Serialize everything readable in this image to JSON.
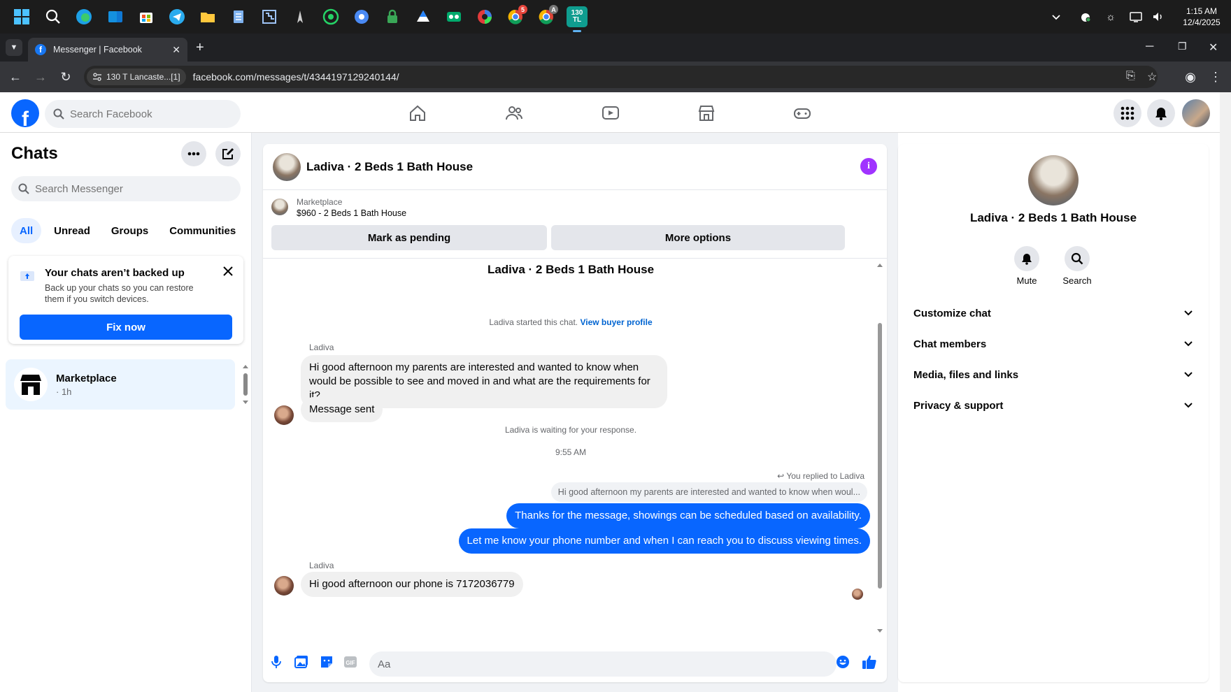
{
  "taskbar": {
    "icons": [
      "windows-start",
      "search",
      "edge",
      "outlook",
      "store",
      "telegram",
      "file-explorer",
      "notepad",
      "snipping",
      "game",
      "whatsapp",
      "chrome-blue",
      "lock-app",
      "drive",
      "tripadvisor",
      "colors",
      "chrome",
      "chrome-profile",
      "trello"
    ],
    "chrome_badge": "5",
    "profile_badge": "A",
    "active_app_label": "130\nTL",
    "time": "1:15 AM",
    "date": "12/4/2025"
  },
  "browser": {
    "tab_title": "Messenger | Facebook",
    "site_chip": "130 T Lancaste...[1]",
    "url": "facebook.com/messages/t/4344197129240144/"
  },
  "fb": {
    "search_placeholder": "Search Facebook"
  },
  "chats": {
    "title": "Chats",
    "search_placeholder": "Search Messenger",
    "filters": [
      "All",
      "Unread",
      "Groups",
      "Communities"
    ],
    "backup_title": "Your chats aren’t backed up",
    "backup_body": "Back up your chats so you can restore them if you switch devices.",
    "fix_now": "Fix now",
    "item_name": "Marketplace",
    "item_time": "· 1h"
  },
  "conversation": {
    "title": "Ladiva · 2 Beds 1 Bath House",
    "marketplace_label": "Marketplace",
    "listing": "$960 - 2 Beds 1 Bath House",
    "mark_pending": "Mark as pending",
    "more_options": "More options",
    "started_text": "Ladiva started this chat.",
    "view_buyer_profile": "View buyer profile",
    "sender": "Ladiva",
    "msg1": "Hi good afternoon my parents are interested and wanted to know when would be possible to see and moved in and what are the requirements for it?",
    "msg2": "Message sent",
    "waiting": "Ladiva is waiting for your response.",
    "timestamp": "9:55 AM",
    "replied": "You replied to Ladiva",
    "quoted": "Hi good afternoon my parents are interested and wanted to know when woul...",
    "out1": "Thanks for the message, showings can be scheduled based on availability.",
    "out2": "Let me know your phone number and when I can reach you to discuss viewing times.",
    "msg3": "Hi good afternoon our phone is 7172036779",
    "input_placeholder": "Aa"
  },
  "details": {
    "name": "Ladiva · 2 Beds 1 Bath House",
    "mute": "Mute",
    "search": "Search",
    "rows": [
      "Customize chat",
      "Chat members",
      "Media, files and links",
      "Privacy & support"
    ]
  },
  "colors": {
    "fb_blue": "#0866ff",
    "info_purple": "#a033ff"
  }
}
